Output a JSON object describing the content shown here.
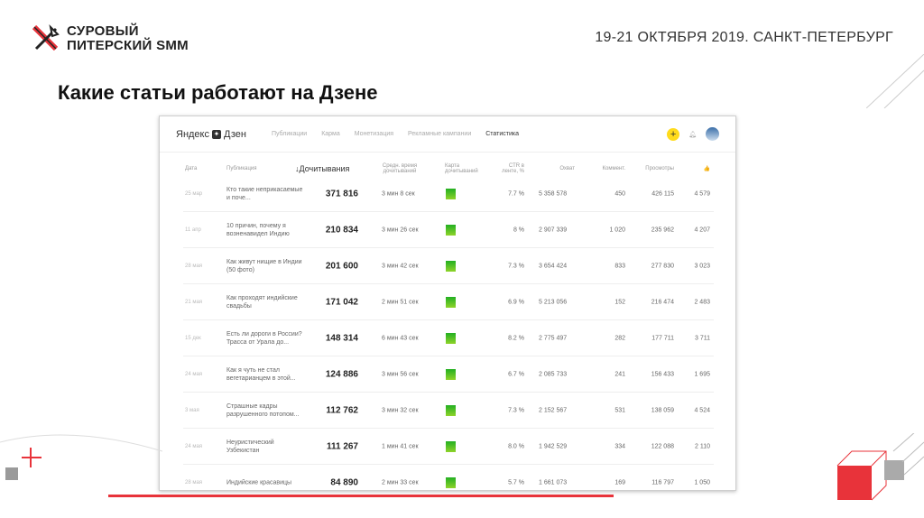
{
  "slide": {
    "logo_line1": "СУРОВЫЙ",
    "logo_line2": "ПИТЕРСКИЙ SMM",
    "event": "19-21 ОКТЯБРЯ 2019. САНКТ-ПЕТЕРБУРГ",
    "title": "Какие статьи работают на Дзене"
  },
  "zen": {
    "brand": "Яндекс",
    "brand2": "Дзен",
    "nav": [
      "Публикации",
      "Карма",
      "Монетизация",
      "Рекламные кампании",
      "Статистика"
    ],
    "plus": "+"
  },
  "columns": [
    "Дата",
    "Публикация",
    "↓Дочитывания",
    "Средн. время дочитываний",
    "Карта дочитываний",
    "CTR в ленте, %",
    "Охват",
    "Коммент.",
    "Просмотры",
    "👍"
  ],
  "rows": [
    {
      "date": "25 мар",
      "title": "Кто такие неприкасаемые и поче...",
      "reads": "371 816",
      "time": "3 мин 8 сек",
      "ctr": "7.7 %",
      "reach": "5 358 578",
      "comments": "450",
      "views": "426 115",
      "likes": "4 579"
    },
    {
      "date": "11 апр",
      "title": "10 причин, почему я возненавидел Индию",
      "reads": "210 834",
      "time": "3 мин 26 сек",
      "ctr": "8 %",
      "reach": "2 907 339",
      "comments": "1 020",
      "views": "235 962",
      "likes": "4 207"
    },
    {
      "date": "28 мая",
      "title": "Как живут нищие в Индии (50 фото)",
      "reads": "201 600",
      "time": "3 мин 42 сек",
      "ctr": "7.3 %",
      "reach": "3 654 424",
      "comments": "833",
      "views": "277 830",
      "likes": "3 023"
    },
    {
      "date": "21 мая",
      "title": "Как проходят индийские свадьбы",
      "reads": "171 042",
      "time": "2 мин 51 сек",
      "ctr": "6.9 %",
      "reach": "5 213 056",
      "comments": "152",
      "views": "216 474",
      "likes": "2 483"
    },
    {
      "date": "15 дек",
      "title": "Есть ли дороги в России? Трасса от Урала до...",
      "reads": "148 314",
      "time": "6 мин 43 сек",
      "ctr": "8.2 %",
      "reach": "2 775 497",
      "comments": "282",
      "views": "177 711",
      "likes": "3 711"
    },
    {
      "date": "24 мая",
      "title": "Как я чуть не стал вегетарианцем в этой...",
      "reads": "124 886",
      "time": "3 мин 56 сек",
      "ctr": "6.7 %",
      "reach": "2 085 733",
      "comments": "241",
      "views": "156 433",
      "likes": "1 695"
    },
    {
      "date": "3 мая",
      "title": "Страшные кадры разрушенного потопом...",
      "reads": "112 762",
      "time": "3 мин 32 сек",
      "ctr": "7.3 %",
      "reach": "2 152 567",
      "comments": "531",
      "views": "138 059",
      "likes": "4 524"
    },
    {
      "date": "24 мая",
      "title": "Неуристический Узбекистан",
      "reads": "111 267",
      "time": "1 мин 41 сек",
      "ctr": "8.0 %",
      "reach": "1 942 529",
      "comments": "334",
      "views": "122 088",
      "likes": "2 110"
    },
    {
      "date": "28 мая",
      "title": "Индийские красавицы",
      "reads": "84 890",
      "time": "2 мин 33 сек",
      "ctr": "5.7 %",
      "reach": "1 661 073",
      "comments": "169",
      "views": "116 797",
      "likes": "1 050"
    }
  ]
}
